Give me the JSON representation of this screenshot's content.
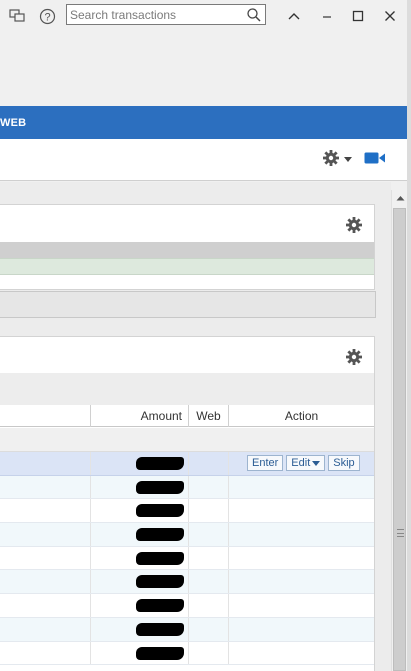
{
  "titlebar": {
    "search_placeholder": "Search transactions",
    "icons": [
      "screens-icon",
      "help-icon",
      "search-icon",
      "chevron-up-icon",
      "minimize-icon",
      "maximize-icon",
      "close-icon"
    ]
  },
  "navbar": {
    "label": "WEB",
    "color": "#2c6fbf"
  },
  "toolbar": {
    "icons": [
      "gear-icon",
      "chevron-down-icon",
      "video-icon"
    ]
  },
  "table": {
    "headers": {
      "amount": "Amount",
      "web": "Web",
      "action": "Action"
    },
    "row_count": 9,
    "selected_row": 0,
    "actions": {
      "enter": "Enter",
      "edit": "Edit",
      "skip": "Skip"
    }
  },
  "colors": {
    "accent": "#2c6fbf",
    "selected_row": "#dbe4f6",
    "alt_row": "#f1f8fb",
    "video_icon": "#1f6fc6"
  }
}
